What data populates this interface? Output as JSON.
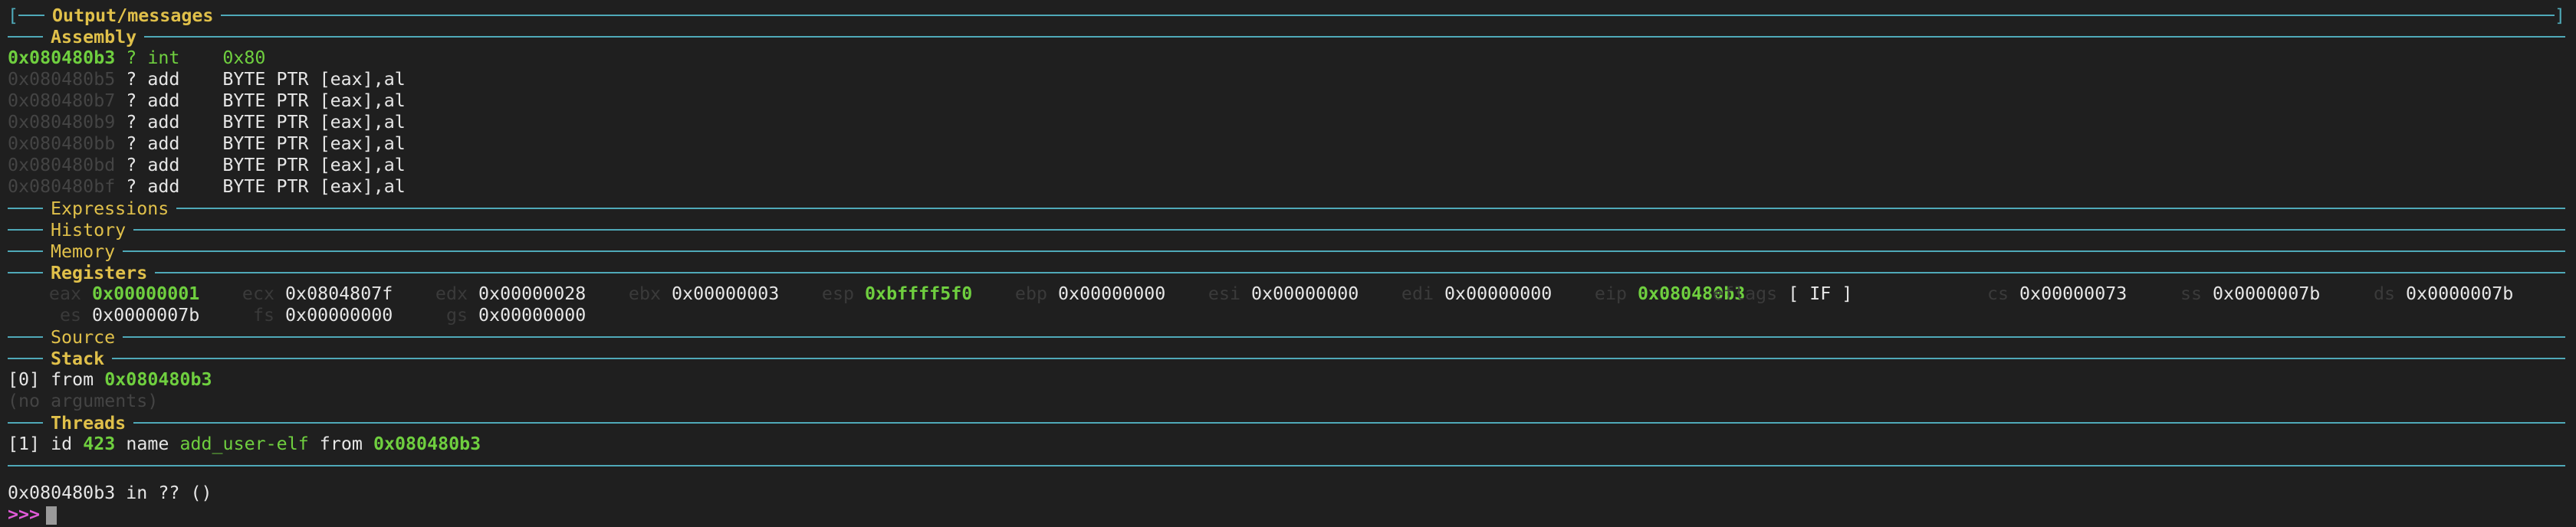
{
  "sections": {
    "output": "Output/messages",
    "assembly": "Assembly",
    "expressions": "Expressions",
    "history": "History",
    "memory": "Memory",
    "registers": "Registers",
    "source": "Source",
    "stack": "Stack",
    "threads": "Threads"
  },
  "assembly": [
    {
      "addr": "0x080480b3",
      "mark": "?",
      "op": "int",
      "args": "0x80",
      "current": true
    },
    {
      "addr": "0x080480b5",
      "mark": "?",
      "op": "add",
      "args": "BYTE PTR [eax],al",
      "current": false
    },
    {
      "addr": "0x080480b7",
      "mark": "?",
      "op": "add",
      "args": "BYTE PTR [eax],al",
      "current": false
    },
    {
      "addr": "0x080480b9",
      "mark": "?",
      "op": "add",
      "args": "BYTE PTR [eax],al",
      "current": false
    },
    {
      "addr": "0x080480bb",
      "mark": "?",
      "op": "add",
      "args": "BYTE PTR [eax],al",
      "current": false
    },
    {
      "addr": "0x080480bd",
      "mark": "?",
      "op": "add",
      "args": "BYTE PTR [eax],al",
      "current": false
    },
    {
      "addr": "0x080480bf",
      "mark": "?",
      "op": "add",
      "args": "BYTE PTR [eax],al",
      "current": false
    }
  ],
  "registers_row1": [
    {
      "name": "eax",
      "value": "0x00000001",
      "changed": true
    },
    {
      "name": "ecx",
      "value": "0x0804807f",
      "changed": false
    },
    {
      "name": "edx",
      "value": "0x00000028",
      "changed": false
    },
    {
      "name": "ebx",
      "value": "0x00000003",
      "changed": false
    },
    {
      "name": "esp",
      "value": "0xbffff5f0",
      "changed": true
    },
    {
      "name": "ebp",
      "value": "0x00000000",
      "changed": false
    },
    {
      "name": "esi",
      "value": "0x00000000",
      "changed": false
    },
    {
      "name": "edi",
      "value": "0x00000000",
      "changed": false
    },
    {
      "name": "eip",
      "value": "0x080480b3",
      "changed": true
    },
    {
      "name": "eflags",
      "value": "[ IF ]",
      "changed": false
    },
    {
      "name": "cs",
      "value": "0x00000073",
      "changed": false
    },
    {
      "name": "ss",
      "value": "0x0000007b",
      "changed": false
    },
    {
      "name": "ds",
      "value": "0x0000007b",
      "changed": false
    }
  ],
  "registers_row2": [
    {
      "name": "es",
      "value": "0x0000007b",
      "changed": false
    },
    {
      "name": "fs",
      "value": "0x00000000",
      "changed": false
    },
    {
      "name": "gs",
      "value": "0x00000000",
      "changed": false
    }
  ],
  "stack": {
    "frame_index": "[0]",
    "from_label": "from",
    "frame_addr": "0x080480b3",
    "no_args": "(no arguments)"
  },
  "threads": {
    "index": "[1]",
    "id_label": "id",
    "id": "423",
    "name_label": "name",
    "name": "add_user-elf",
    "from_label": "from",
    "addr": "0x080480b3"
  },
  "location_line": "0x080480b3 in ?? ()",
  "prompt": ">>>",
  "colors": {
    "bg": "#1f1f1f",
    "rule": "#4fa9b8",
    "title": "#e0c04a",
    "accent": "#6fcf3f",
    "prompt": "#e05ad8"
  }
}
